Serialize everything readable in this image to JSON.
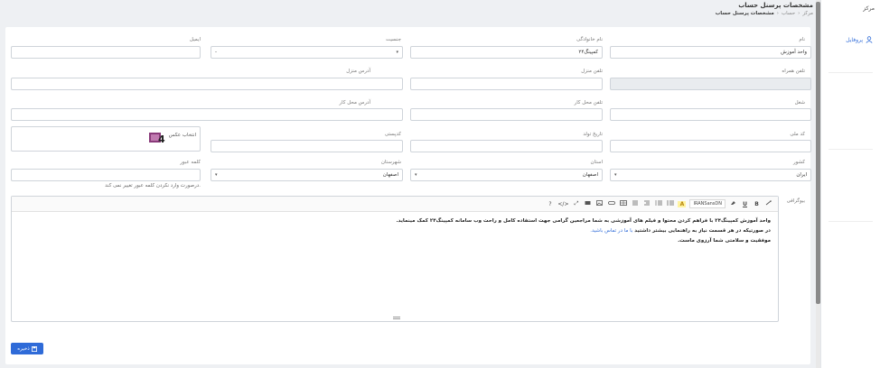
{
  "sidebar": {
    "brand": "مرکز",
    "profile_label": "پروفایل"
  },
  "header": {
    "title": "مشخصات پرسنل حساب",
    "breadcrumb": [
      "مرکز",
      "حساب",
      "مشخصات پرسنل حساب"
    ],
    "breadcrumb_sep": "‹"
  },
  "form": {
    "name": {
      "label": "نام",
      "value": "واحد آموزش"
    },
    "family": {
      "label": "نام خانوادگی",
      "value": "کمپینگ۲۴"
    },
    "gender": {
      "label": "جنسیت",
      "value": "-"
    },
    "email": {
      "label": "ایمیل",
      "value": ""
    },
    "mobile": {
      "label": "تلفن همراه",
      "value": ""
    },
    "home_phone": {
      "label": "تلفن منزل",
      "value": ""
    },
    "home_address": {
      "label": "آدرس منزل",
      "value": ""
    },
    "job": {
      "label": "شغل",
      "value": ""
    },
    "work_phone": {
      "label": "تلفن محل کار",
      "value": ""
    },
    "work_address": {
      "label": "آدرس محل کار",
      "value": ""
    },
    "national_code": {
      "label": "کد ملی",
      "value": ""
    },
    "birth_date": {
      "label": "تاریخ تولد",
      "value": ""
    },
    "postal_code": {
      "label": "کدپستی",
      "value": ""
    },
    "photo": {
      "label": "انتخاب عکس"
    },
    "country": {
      "label": "کشور",
      "value": "ایران"
    },
    "province": {
      "label": "استان",
      "value": "اصفهان"
    },
    "city": {
      "label": "شهرستان",
      "value": "اصفهان"
    },
    "password": {
      "label": "کلمه عبور",
      "value": "",
      "note": "درصورت وارد نکردن کلمه عبور تغییر نمی کند."
    },
    "bio": {
      "label": "بیوگرافی",
      "toolbar": {
        "font": "IRANSansDN",
        "help": "?",
        "code": "</>",
        "fullscreen": "⤢",
        "bold": "B",
        "underline": "U",
        "highlight": "A"
      },
      "lines": [
        "واحد آموزش کمپینگ۲۴ با فراهم کردن محتوا و فیلم های آموزشی به شما مراجعین گرامی جهت استفاده کامل و راحت وب سامانه کمپینگ۲۴ کمک مینماید.",
        "در صورتیکه در هر قسمت نیاز به راهنمایی بیشتر داشتید",
        "با ما در تماس باشید.",
        "موفقیت و سلامتی شما آرزوی ماست."
      ]
    }
  },
  "save_label": "ذخیره"
}
